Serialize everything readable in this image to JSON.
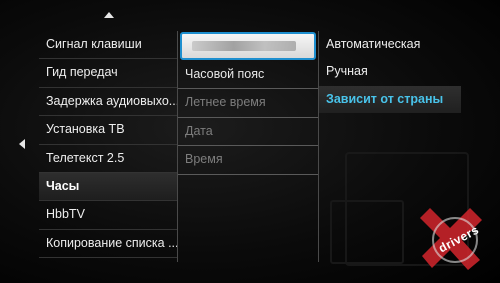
{
  "menu": {
    "items": [
      {
        "label": "Сигнал клавиши"
      },
      {
        "label": "Гид передач"
      },
      {
        "label": "Задержка аудиовыхо..."
      },
      {
        "label": "Установка ТВ"
      },
      {
        "label": "Телетекст 2.5"
      },
      {
        "label": "Часы",
        "selected": true
      },
      {
        "label": "HbbTV"
      },
      {
        "label": "Копирование списка ..."
      }
    ]
  },
  "clock_menu": {
    "items": [
      {
        "label": "",
        "focused": true
      },
      {
        "label": "Часовой пояс"
      },
      {
        "label": "Летнее время",
        "disabled": true
      },
      {
        "label": "Дата",
        "disabled": true
      },
      {
        "label": "Время",
        "disabled": true
      }
    ]
  },
  "mode_menu": {
    "items": [
      {
        "label": "Автоматическая"
      },
      {
        "label": "Ручная"
      },
      {
        "label": "Зависит от страны",
        "selected": true
      }
    ]
  },
  "watermark": {
    "text": "drivers"
  },
  "colors": {
    "accent": "#49c3ea",
    "focus_border": "#1e8fcf"
  }
}
